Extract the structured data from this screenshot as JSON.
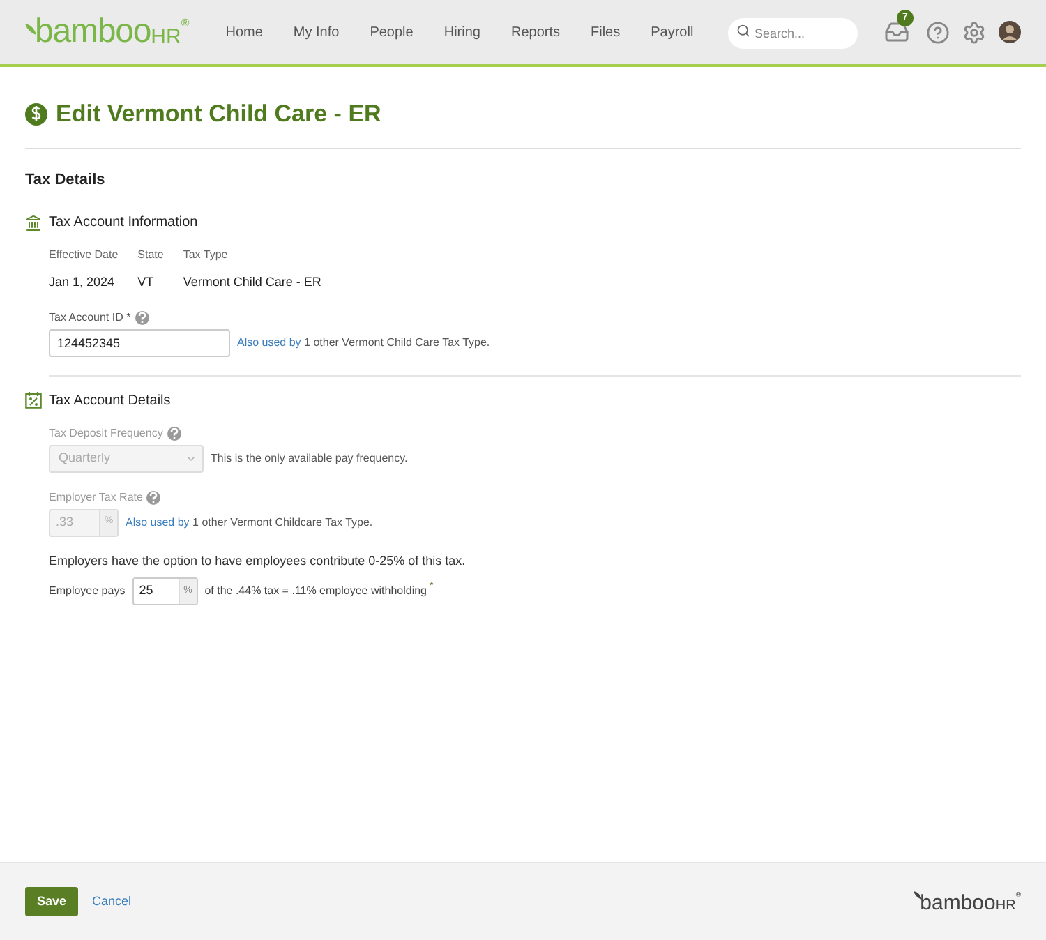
{
  "header": {
    "logo": {
      "word": "bamboo",
      "suffix": "HR",
      "mark": "®"
    },
    "nav": [
      {
        "label": "Home",
        "selected": false
      },
      {
        "label": "My Info",
        "selected": false
      },
      {
        "label": "People",
        "selected": false
      },
      {
        "label": "Hiring",
        "selected": false
      },
      {
        "label": "Reports",
        "selected": false
      },
      {
        "label": "Files",
        "selected": false
      },
      {
        "label": "Payroll",
        "selected": false
      }
    ],
    "search": {
      "placeholder": "Search..."
    },
    "inbox_count": "7"
  },
  "page": {
    "title": "Edit Vermont Child Care - ER"
  },
  "tax_details": {
    "heading": "Tax Details",
    "info": {
      "heading": "Tax Account Information",
      "columns": [
        "Effective Date",
        "State",
        "Tax Type"
      ],
      "values": [
        "Jan 1, 2024",
        "VT",
        "Vermont Child Care - ER"
      ],
      "account_id": {
        "label": "Tax Account ID",
        "required": "*",
        "value": "124452345",
        "link": "Also used by",
        "note": "1 other Vermont Child Care Tax Type."
      }
    },
    "details": {
      "heading": "Tax Account Details",
      "frequency": {
        "label": "Tax Deposit Frequency",
        "value": "Quarterly",
        "disabled": true,
        "note": "This is the only available pay frequency."
      },
      "rate": {
        "label": "Employer Tax Rate",
        "value": ".33",
        "unit": "%",
        "disabled": true,
        "link": "Also used by",
        "note": "1 other Vermont Childcare Tax Type."
      },
      "option_text": "Employers have the option to have employees contribute 0-25% of this tax.",
      "employee": {
        "label": "Employee pays",
        "value": "25",
        "unit": "%",
        "disabled": false,
        "note": "of the .44% tax = .11% employee withholding",
        "mark": "*"
      }
    }
  },
  "footer": {
    "save": "Save",
    "cancel": "Cancel",
    "logo": {
      "word": "bamboo",
      "suffix": "HR",
      "mark": "®"
    }
  }
}
